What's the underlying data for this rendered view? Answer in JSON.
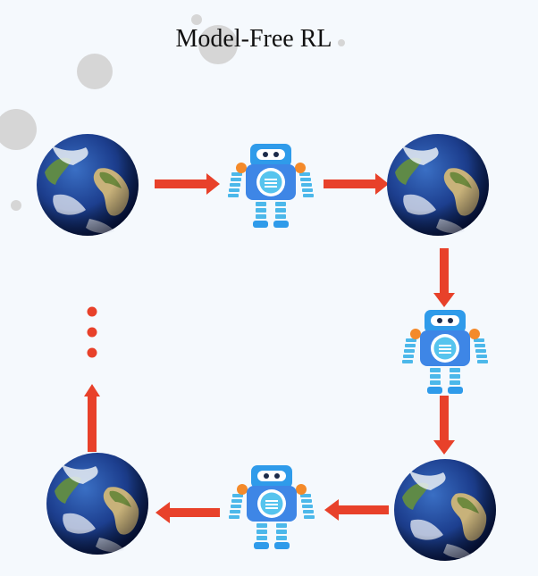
{
  "title": "Model-Free RL",
  "nodes": [
    {
      "kind": "environment",
      "icon": "earth-globe-icon"
    },
    {
      "kind": "agent",
      "icon": "robot-icon"
    },
    {
      "kind": "environment",
      "icon": "earth-globe-icon"
    },
    {
      "kind": "agent",
      "icon": "robot-icon"
    },
    {
      "kind": "environment",
      "icon": "earth-globe-icon"
    },
    {
      "kind": "agent",
      "icon": "robot-icon"
    },
    {
      "kind": "environment",
      "icon": "earth-globe-icon"
    }
  ],
  "colors": {
    "arrow": "#e8412a",
    "background": "#f5f9fd",
    "robot_body": "#3e86e6",
    "robot_head": "#2f9bea",
    "robot_limb": "#4cb8ea",
    "robot_shoulder": "#f48a2a",
    "bubble": "#d6d6d6"
  }
}
